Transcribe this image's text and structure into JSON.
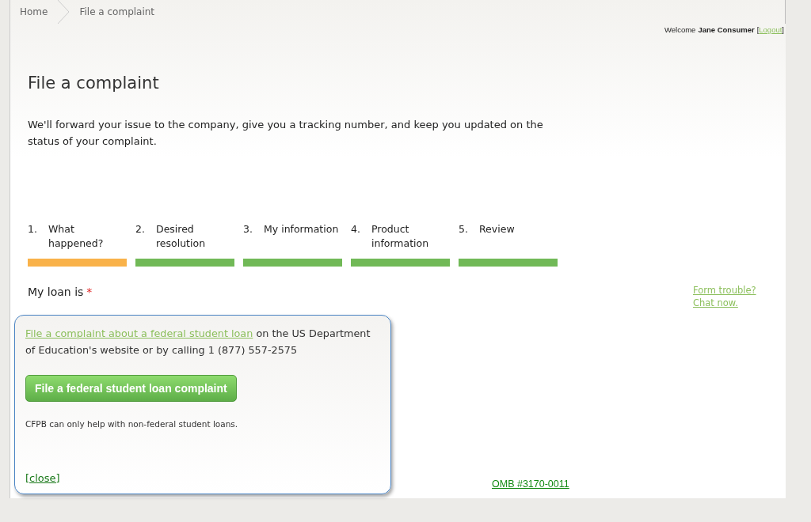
{
  "breadcrumb": [
    {
      "label": "Home"
    },
    {
      "label": "File a complaint"
    }
  ],
  "user": {
    "greeting": "Welcome",
    "name": "Jane Consumer",
    "bracket_open": "[",
    "logout": "Logout",
    "bracket_close": "]"
  },
  "title": "File a complaint",
  "intro": "We'll forward your issue to the company, give you a tracking number, and keep you updated on the status of your complaint.",
  "steps": [
    {
      "number": "1.",
      "label": "What happened?",
      "selected": true
    },
    {
      "number": "2.",
      "label": "Desired resolution",
      "selected": false
    },
    {
      "number": "3.",
      "label": "My information",
      "selected": false
    },
    {
      "number": "4.",
      "label": "Product information",
      "selected": false
    },
    {
      "number": "5.",
      "label": "Review",
      "selected": false
    }
  ],
  "field_label": "My loan is",
  "required_mark": "*",
  "help": {
    "line1": "Form trouble?",
    "line2": "Chat now."
  },
  "popup": {
    "link": "File a complaint about a federal student loan",
    "text": "on the US Department of Education's website or by calling 1 (877) 557-2575",
    "button": "File a federal student loan complaint",
    "note": "CFPB can only help with non-federal student loans.",
    "close": "[close]"
  },
  "footer_link": "OMB #3170-0011"
}
